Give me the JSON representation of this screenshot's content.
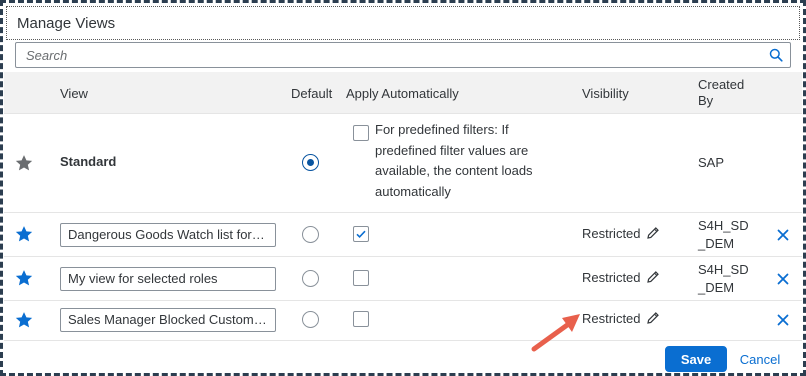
{
  "dialog": {
    "title": "Manage Views"
  },
  "search": {
    "placeholder": "Search",
    "icon": "search-icon"
  },
  "table": {
    "headers": {
      "view": "View",
      "default": "Default",
      "apply": "Apply Automatically",
      "visibility": "Visibility",
      "created_by_1": "Created",
      "created_by_2": "By"
    },
    "rows": [
      {
        "favorite": true,
        "favorite_color": "#6a6d70",
        "view": "Standard",
        "is_default": true,
        "apply_auto": false,
        "apply_note_lines": [
          "For predefined filters: If",
          "predefined filter values are",
          "available, the content loads",
          "automatically"
        ],
        "visibility": "",
        "created_by_lines": [
          "SAP"
        ],
        "deletable": false
      },
      {
        "favorite": true,
        "favorite_color": "#0a6ed1",
        "view": "Dangerous Goods Watch list for S...",
        "is_default": false,
        "apply_auto": true,
        "visibility": "Restricted",
        "created_by_lines": [
          "S4H_SD",
          "_DEM"
        ],
        "deletable": true
      },
      {
        "favorite": true,
        "favorite_color": "#0a6ed1",
        "view": "My view for selected roles",
        "is_default": false,
        "apply_auto": false,
        "visibility": "Restricted",
        "created_by_lines": [
          "S4H_SD",
          "_DEM"
        ],
        "deletable": true
      },
      {
        "favorite": true,
        "favorite_color": "#0a6ed1",
        "view": "Sales Manager Blocked Customer...",
        "is_default": false,
        "apply_auto": false,
        "visibility": "Restricted",
        "created_by_lines": [],
        "deletable": true
      }
    ]
  },
  "footer": {
    "save_label": "Save",
    "cancel_label": "Cancel"
  },
  "colors": {
    "accent": "#0a6ed1",
    "annotation_arrow": "#e8604c"
  }
}
